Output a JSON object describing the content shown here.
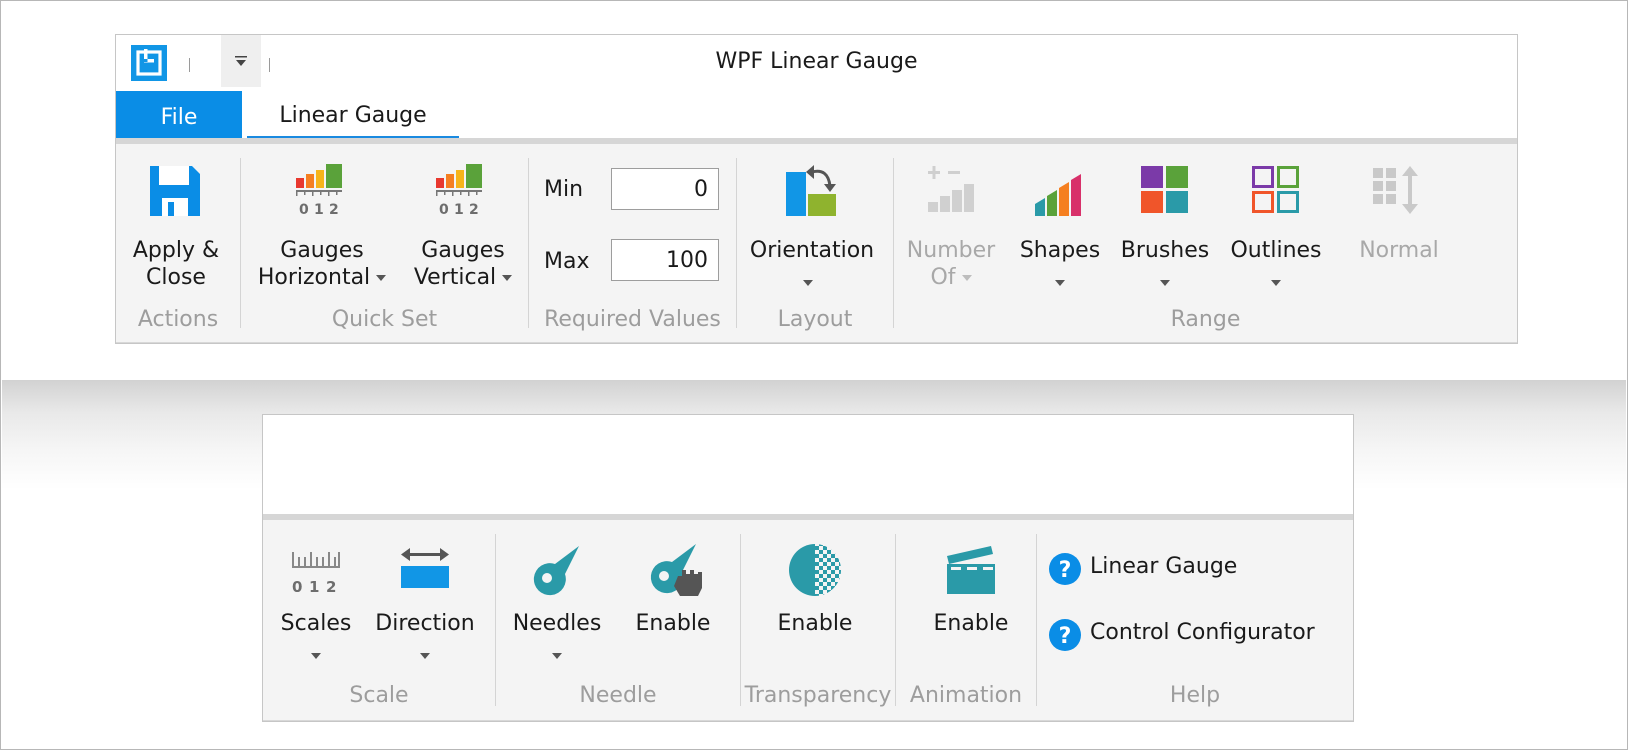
{
  "window": {
    "title": "WPF Linear Gauge",
    "tabs": [
      {
        "label": "File",
        "active": false
      },
      {
        "label": "Linear Gauge",
        "active": true
      }
    ]
  },
  "ribbon_top": {
    "groups": [
      {
        "name": "Actions",
        "buttons": [
          {
            "label_line1": "Apply &",
            "label_line2": "Close",
            "icon": "save-icon"
          }
        ]
      },
      {
        "name": "Quick Set",
        "buttons": [
          {
            "label_line1": "Gauges",
            "label_line2": "Horizontal",
            "icon": "gauge-horizontal-icon",
            "dropdown": true
          },
          {
            "label_line1": "Gauges",
            "label_line2": "Vertical",
            "icon": "gauge-vertical-icon",
            "dropdown": true
          }
        ]
      },
      {
        "name": "Required Values",
        "fields": [
          {
            "label": "Min",
            "value": "0"
          },
          {
            "label": "Max",
            "value": "100"
          }
        ]
      },
      {
        "name": "Layout",
        "buttons": [
          {
            "label": "Orientation",
            "icon": "orientation-icon",
            "dropdown": true
          }
        ]
      },
      {
        "name": "Range",
        "buttons": [
          {
            "label_line1": "Number",
            "label_line2": "Of",
            "icon": "number-of-icon",
            "dropdown": true,
            "enabled": false
          },
          {
            "label": "Shapes",
            "icon": "shapes-icon",
            "dropdown": true
          },
          {
            "label": "Brushes",
            "icon": "brushes-icon",
            "dropdown": true
          },
          {
            "label": "Outlines",
            "icon": "outlines-icon",
            "dropdown": true
          },
          {
            "label": "Normal",
            "icon": "normal-icon",
            "enabled": false
          }
        ]
      }
    ]
  },
  "ribbon_bottom": {
    "groups": [
      {
        "name": "Scale",
        "buttons": [
          {
            "label": "Scales",
            "icon": "scales-icon",
            "dropdown": true
          },
          {
            "label": "Direction",
            "icon": "direction-icon",
            "dropdown": true
          }
        ]
      },
      {
        "name": "Needle",
        "buttons": [
          {
            "label": "Needles",
            "icon": "needle-icon",
            "dropdown": true
          },
          {
            "label": "Enable",
            "icon": "needle-enable-icon"
          }
        ]
      },
      {
        "name": "Transparency",
        "buttons": [
          {
            "label": "Enable",
            "icon": "transparency-icon"
          }
        ]
      },
      {
        "name": "Animation",
        "buttons": [
          {
            "label": "Enable",
            "icon": "animation-icon"
          }
        ]
      },
      {
        "name": "Help",
        "items": [
          {
            "label": "Linear Gauge",
            "icon": "help-icon"
          },
          {
            "label": "Control Configurator",
            "icon": "help-icon"
          }
        ]
      }
    ]
  },
  "gauge_icon_ticks": [
    "0",
    "1",
    "2"
  ],
  "colors": {
    "accent": "#0a8de6",
    "teal": "#2a9aa8",
    "disabled": "#a8a8a8"
  }
}
